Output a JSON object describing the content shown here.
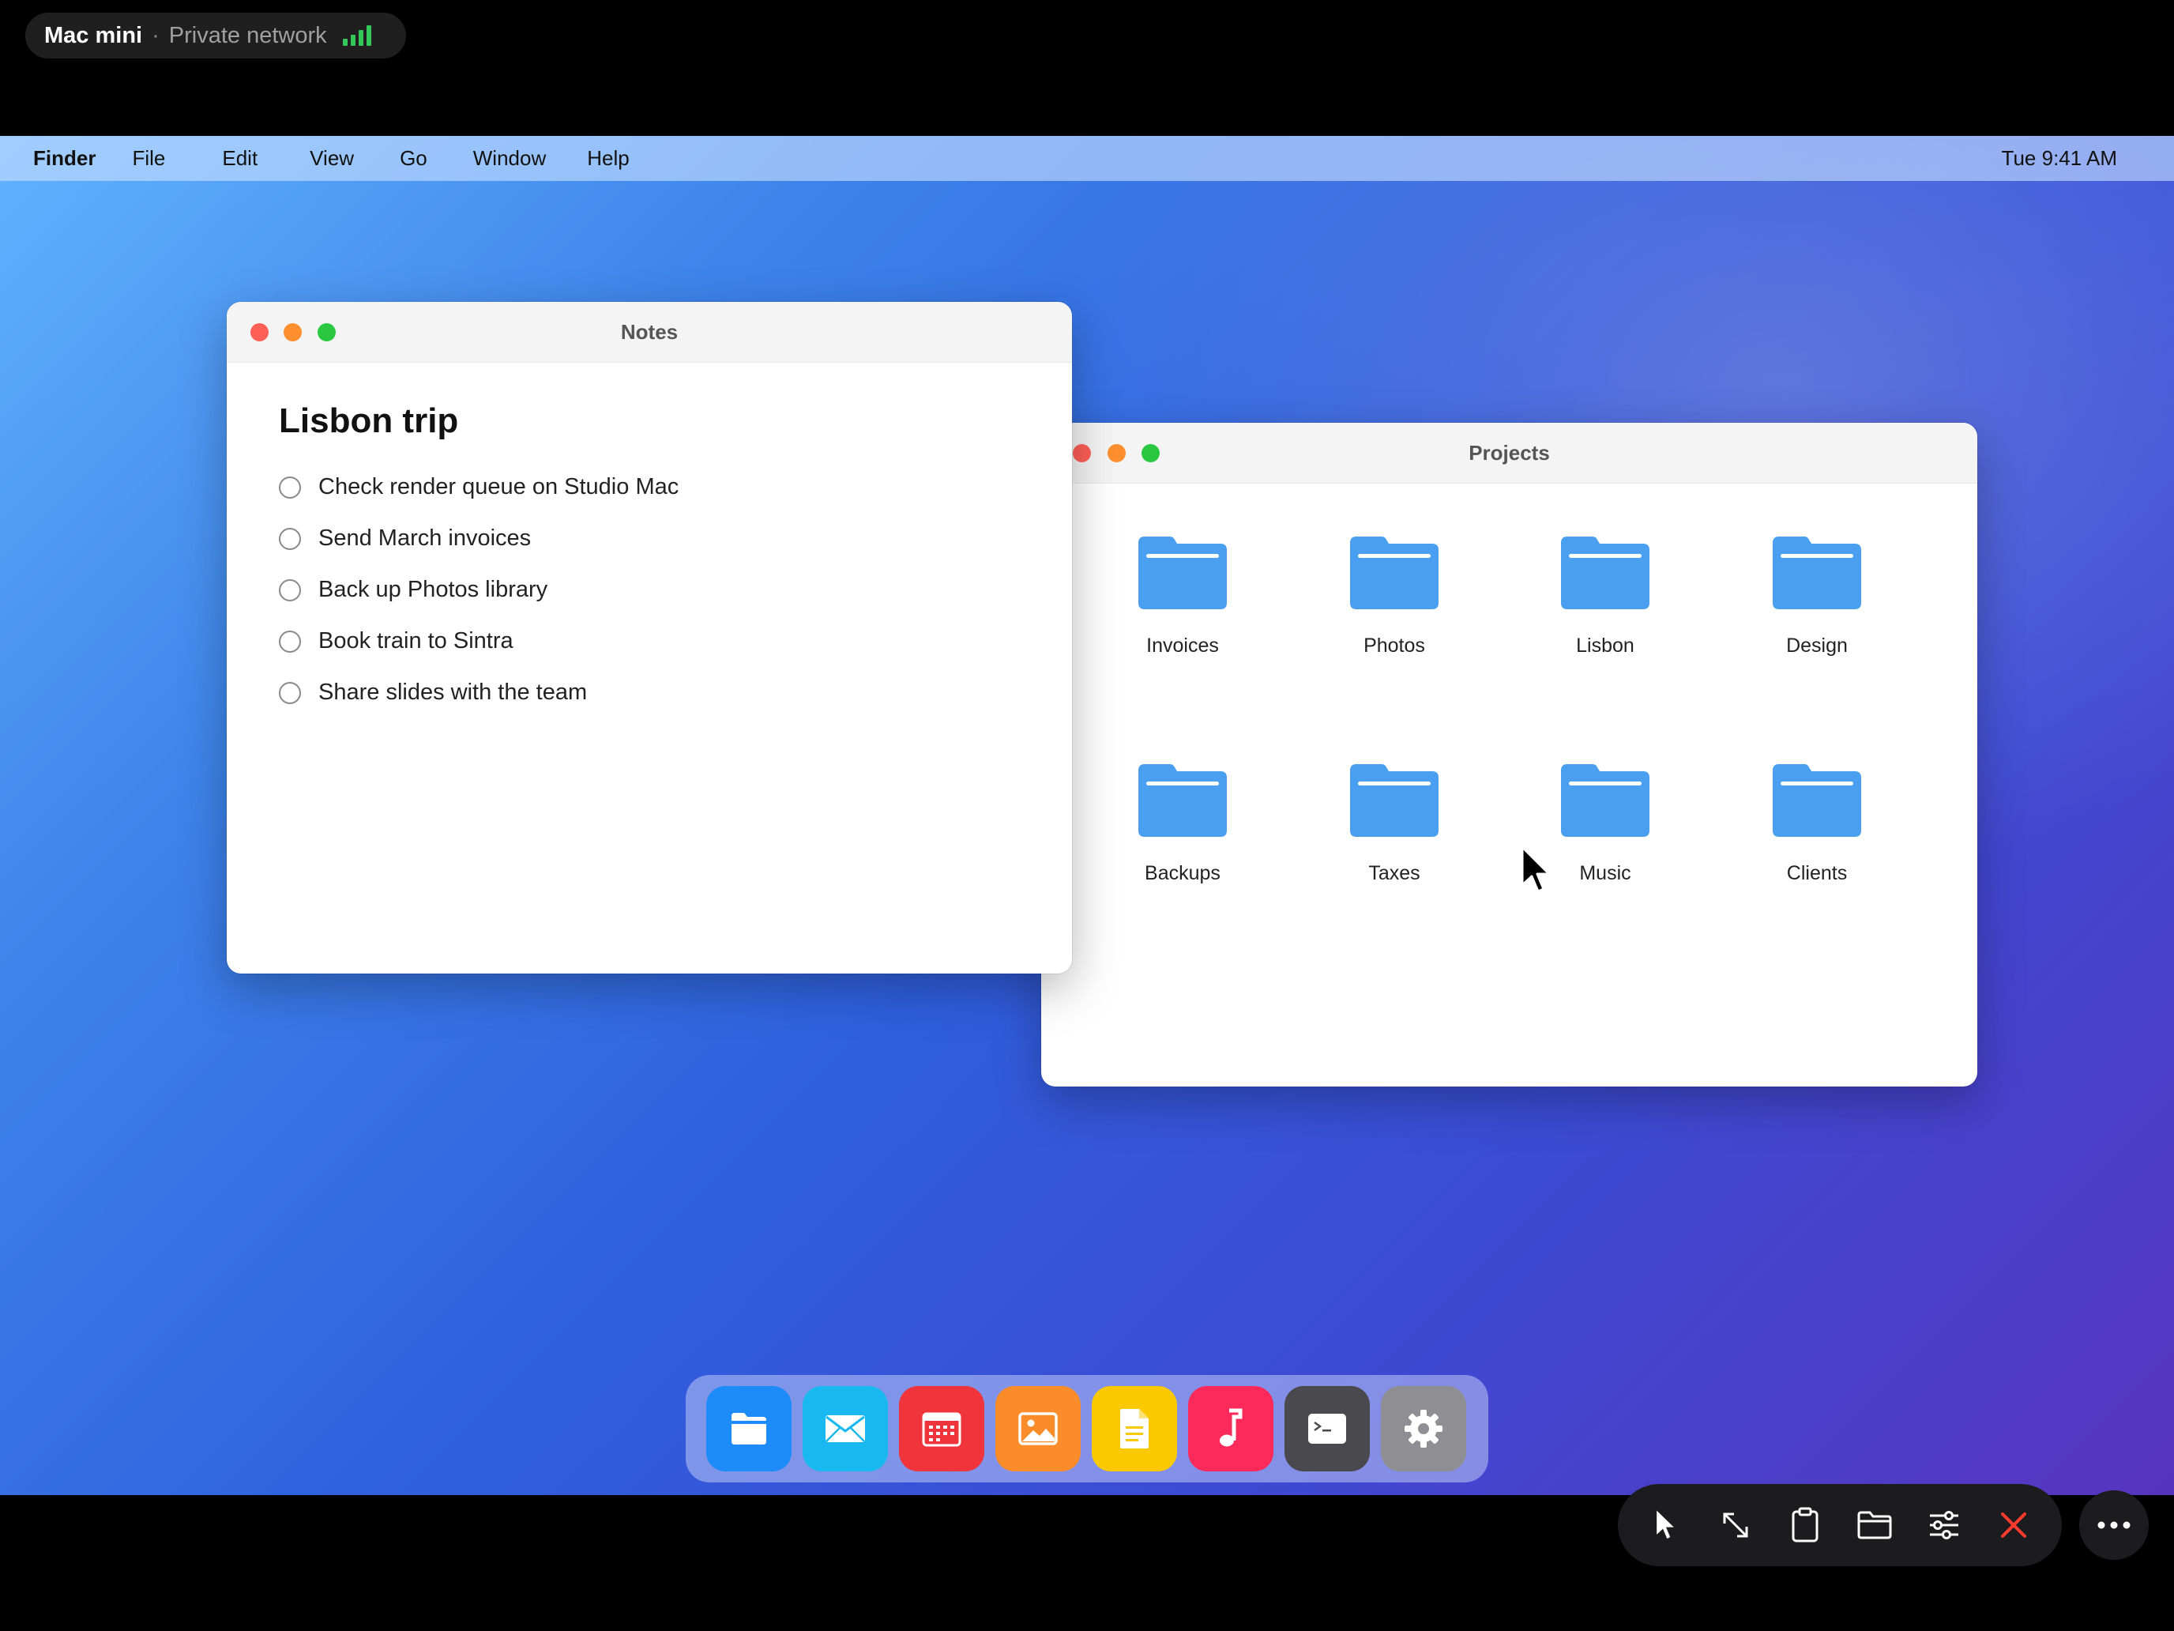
{
  "status": {
    "host": "Mac mini",
    "separator": "·",
    "network": "Private network",
    "signal_color": "#34c759"
  },
  "menubar": {
    "items": [
      "Finder",
      "File",
      "Edit",
      "View",
      "Go",
      "Window",
      "Help"
    ],
    "clock": "Tue 9:41 AM"
  },
  "notes_window": {
    "title": "Notes",
    "heading": "Lisbon trip",
    "todos": [
      "Check render queue on Studio Mac",
      "Send March invoices",
      "Back up Photos library",
      "Book train to Sintra",
      "Share slides with the team"
    ]
  },
  "projects_window": {
    "title": "Projects",
    "folders": [
      "Invoices",
      "Photos",
      "Lisbon",
      "Design",
      "Backups",
      "Taxes",
      "Music",
      "Clients"
    ],
    "folder_color": "#4a9ff0"
  },
  "dock": {
    "apps": [
      {
        "name": "Finder",
        "icon": "folder-icon",
        "color": "#1e8cf8"
      },
      {
        "name": "Mail",
        "icon": "envelope-icon",
        "color": "#1ab8f0"
      },
      {
        "name": "Calendar",
        "icon": "calendar-icon",
        "color": "#f0343c"
      },
      {
        "name": "Photos",
        "icon": "image-icon",
        "color": "#fb8c2a"
      },
      {
        "name": "Pages",
        "icon": "document-icon",
        "color": "#fcc800"
      },
      {
        "name": "Music",
        "icon": "music-note-icon",
        "color": "#fc2a5a"
      },
      {
        "name": "Terminal",
        "icon": "terminal-icon",
        "color": "#4a4a4e"
      },
      {
        "name": "Settings",
        "icon": "gear-icon",
        "color": "#8e8e93"
      }
    ]
  },
  "remote_toolbar": {
    "tools": [
      "pointer-icon",
      "resize-icon",
      "clipboard-icon",
      "folder-icon",
      "sliders-icon",
      "close-icon"
    ],
    "close_color": "#ff3b30",
    "more": "more-icon"
  }
}
